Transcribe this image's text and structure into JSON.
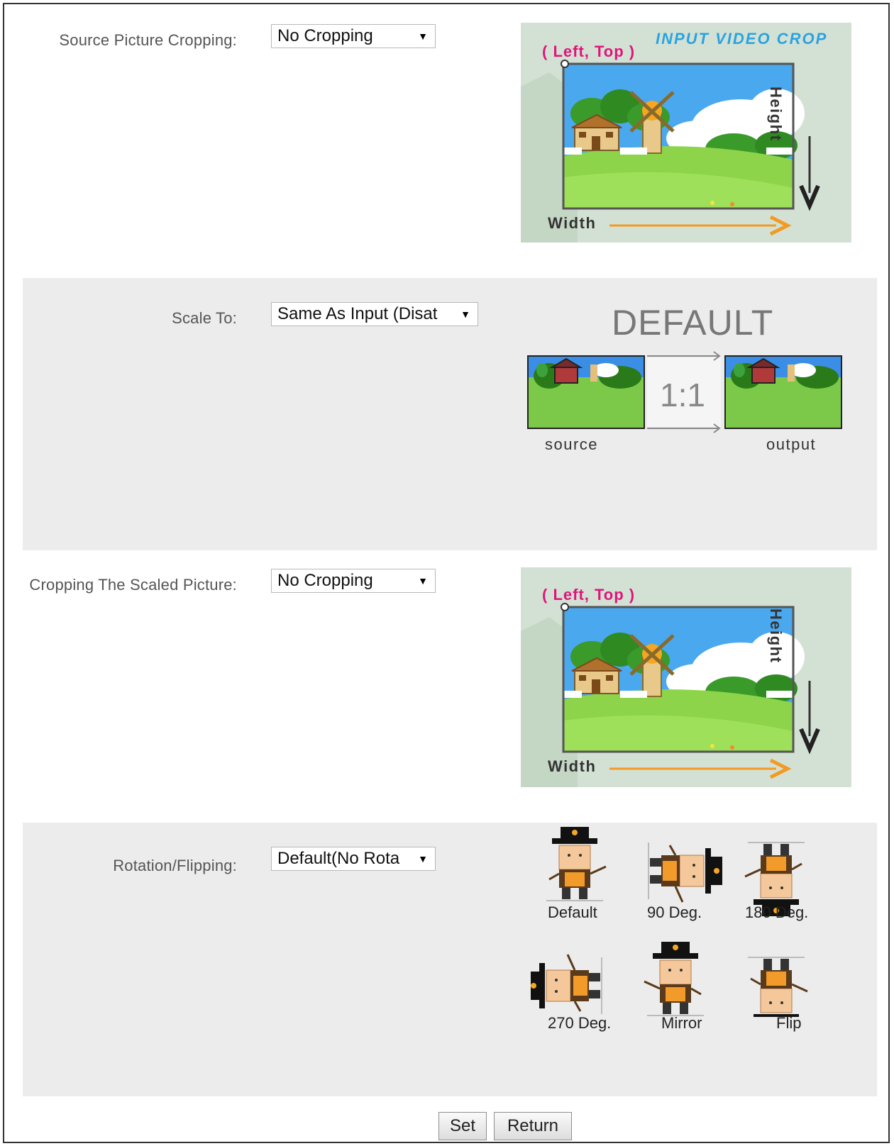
{
  "rows": {
    "source_crop": {
      "label": "Source Picture Cropping:",
      "value": "No Cropping"
    },
    "scale": {
      "label": "Scale To:",
      "value": "Same As Input (Disat"
    },
    "scaled_crop": {
      "label": "Cropping The Scaled Picture:",
      "value": "No Cropping"
    },
    "rotation": {
      "label": "Rotation/Flipping:",
      "value": "Default(No Rota"
    }
  },
  "crop_illustration": {
    "title": "INPUT VIDEO CROP",
    "corner_label": "( Left, Top )",
    "width_label": "Width",
    "height_label": "Height"
  },
  "scale_illustration": {
    "heading": "DEFAULT",
    "ratio": "1:1",
    "source_label": "source",
    "output_label": "output"
  },
  "rotation_options": [
    "Default",
    "90 Deg.",
    "180 Deg.",
    "270 Deg.",
    "Mirror",
    "Flip"
  ],
  "buttons": {
    "set": "Set",
    "return": "Return"
  },
  "colors": {
    "accent_magenta": "#e0157a",
    "accent_blue": "#2aa3df",
    "arrow_orange": "#f39a24",
    "section_gray": "#ececec"
  }
}
